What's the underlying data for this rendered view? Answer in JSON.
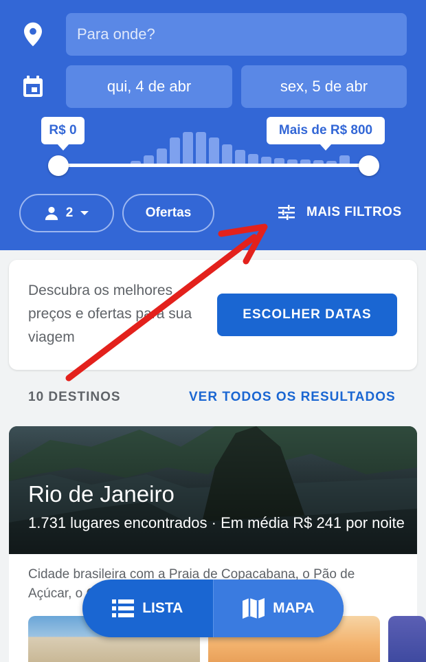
{
  "search": {
    "destination_placeholder": "Para onde?",
    "checkin": "qui, 4 de abr",
    "checkout": "sex, 5 de abr"
  },
  "price": {
    "min_label": "R$ 0",
    "max_label": "Mais de R$ 800",
    "range_selected": [
      0,
      1
    ]
  },
  "filters": {
    "guests": "2",
    "offers": "Ofertas",
    "more_filters": "MAIS FILTROS"
  },
  "promo": {
    "text": "Descubra os melhores preços e ofertas para sua viagem",
    "cta": "ESCOLHER DATAS"
  },
  "results": {
    "count": "10 DESTINOS",
    "see_all": "VER TODOS OS RESULTADOS"
  },
  "destination": {
    "name": "Rio de Janeiro",
    "summary": "1.731 lugares encontrados · Em média R$ 241 por noite",
    "description": "Cidade brasileira com a Praia de Copacabana, o Pão de Açúcar, o Cristo Redentor"
  },
  "view_toggle": {
    "list": "LISTA",
    "map": "MAPA"
  },
  "colors": {
    "primary": "#3367d6",
    "accent_button": "#1a66d2",
    "annotation_arrow": "#e3211c"
  }
}
